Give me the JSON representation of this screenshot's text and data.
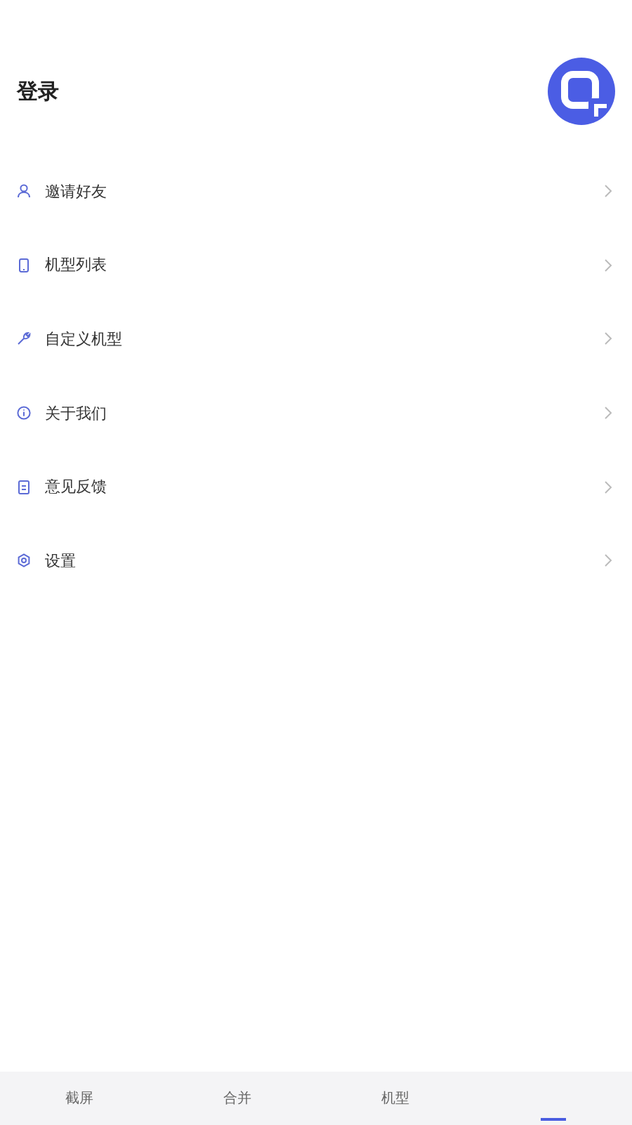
{
  "header": {
    "title": "登录"
  },
  "menu": [
    {
      "label": "邀请好友",
      "kind": "person"
    },
    {
      "label": "机型列表",
      "kind": "phone"
    },
    {
      "label": "自定义机型",
      "kind": "wrench"
    },
    {
      "label": "关于我们",
      "kind": "info"
    },
    {
      "label": "意见反馈",
      "kind": "document"
    },
    {
      "label": "设置",
      "kind": "gear"
    }
  ],
  "tabs": [
    {
      "label": "截屏",
      "selected": false
    },
    {
      "label": "合并",
      "selected": false
    },
    {
      "label": "机型",
      "selected": false
    },
    {
      "selected": true
    }
  ]
}
